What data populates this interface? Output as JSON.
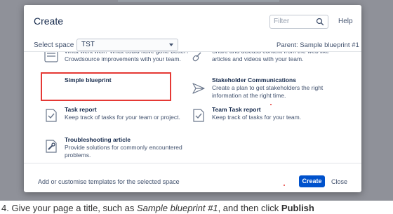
{
  "dialog": {
    "title": "Create",
    "filter_placeholder": "Filter",
    "help_label": "Help",
    "select_space_label": "Select space",
    "space_value": "TST",
    "parent_text": "Parent: Sample blueprint #1"
  },
  "templates": [
    {
      "name": "",
      "desc": "What went well? What could have gone better? Crowdsource improvements with your team.",
      "icon": "list-icon"
    },
    {
      "name": "",
      "desc": "Share and discuss content from the web like articles and videos with your team.",
      "icon": "share-link-icon"
    },
    {
      "name": "Simple blueprint",
      "desc": "",
      "icon": "none"
    },
    {
      "name": "Stakeholder Communications",
      "desc": "Create a plan to get stakeholders the right information at the right time.",
      "icon": "send-icon"
    },
    {
      "name": "Task report",
      "desc": "Keep track of tasks for your team or project.",
      "icon": "task-report-icon"
    },
    {
      "name": "Team Task report",
      "desc": "Keep track of tasks for your team.",
      "icon": "team-task-report-icon"
    },
    {
      "name": "Troubleshooting article",
      "desc": "Provide solutions for commonly encountered problems.",
      "icon": "troubleshooting-icon"
    }
  ],
  "footer": {
    "customise_text": "Add or customise templates for the selected space",
    "create_label": "Create",
    "close_label": "Close"
  },
  "caption": {
    "prefix": "4. Give your page a title, such as ",
    "italic": "Sample blueprint #1",
    "middle": ", and then click ",
    "bold": "Publish"
  },
  "colors": {
    "primary": "#0052cc",
    "highlight": "#e53935",
    "backdrop": "#8f9199"
  }
}
